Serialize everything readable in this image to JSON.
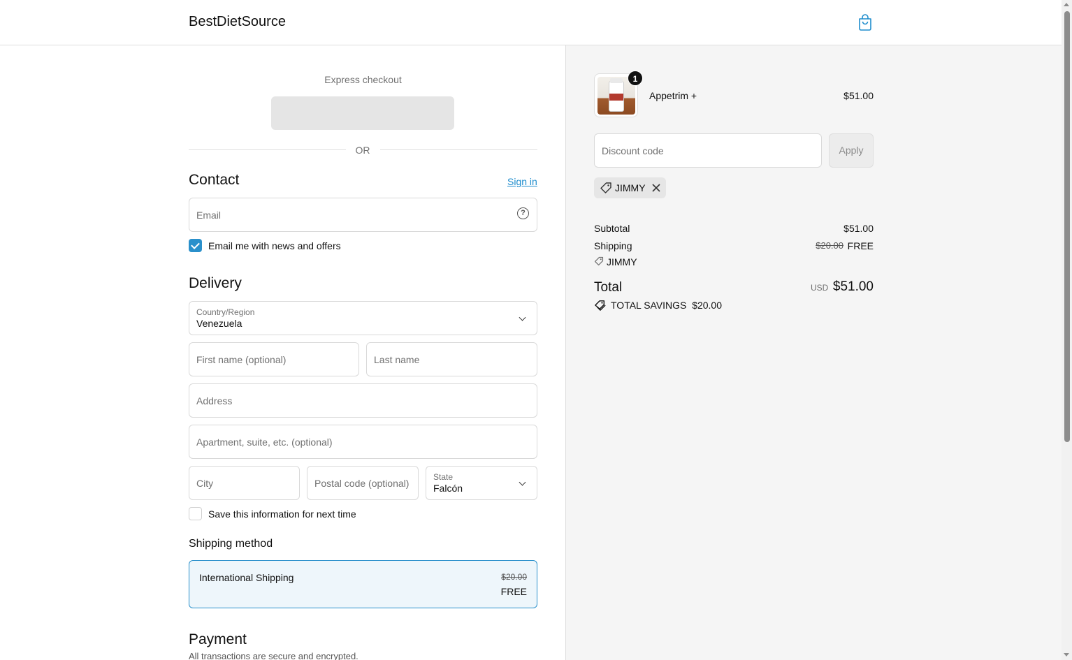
{
  "header": {
    "brand": "BestDietSource",
    "cart_icon": "shopping-bag-icon"
  },
  "express": {
    "title": "Express checkout",
    "or": "OR"
  },
  "contact": {
    "title": "Contact",
    "sign_in": "Sign in",
    "email_placeholder": "Email",
    "newsletter_label": "Email me with news and offers",
    "newsletter_checked": true
  },
  "delivery": {
    "title": "Delivery",
    "country_label": "Country/Region",
    "country_value": "Venezuela",
    "first_name_placeholder": "First name (optional)",
    "last_name_placeholder": "Last name",
    "address_placeholder": "Address",
    "apartment_placeholder": "Apartment, suite, etc. (optional)",
    "city_placeholder": "City",
    "postal_placeholder": "Postal code (optional)",
    "state_label": "State",
    "state_value": "Falcón",
    "save_info_label": "Save this information for next time",
    "save_info_checked": false
  },
  "shipping_method": {
    "title": "Shipping method",
    "name": "International Shipping",
    "old_price": "$20.00",
    "price": "FREE"
  },
  "payment": {
    "title": "Payment",
    "subtitle": "All transactions are secure and encrypted."
  },
  "summary": {
    "item": {
      "name": "Appetrim +",
      "price": "$51.00",
      "quantity": "1"
    },
    "discount_placeholder": "Discount code",
    "apply_label": "Apply",
    "discount_chip": "JIMMY",
    "subtotal_label": "Subtotal",
    "subtotal_value": "$51.00",
    "shipping_label": "Shipping",
    "shipping_old": "$20.00",
    "shipping_value": "FREE",
    "shipping_discount_code": "JIMMY",
    "total_label": "Total",
    "total_currency": "USD",
    "total_value": "$51.00",
    "savings_label": "TOTAL SAVINGS",
    "savings_value": "$20.00"
  },
  "colors": {
    "accent": "#2a90cb",
    "link": "#1f8dcd",
    "summary_bg": "#f5f5f5"
  }
}
